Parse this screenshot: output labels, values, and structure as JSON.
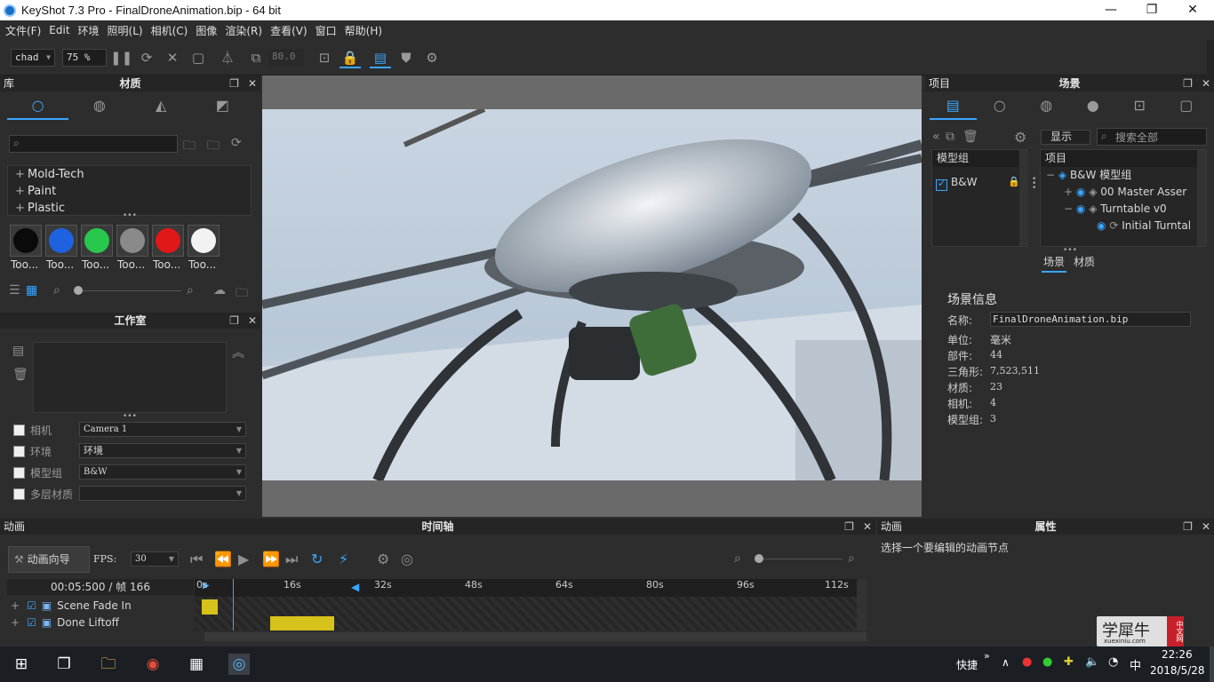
{
  "window": {
    "title": "KeyShot 7.3 Pro  - FinalDroneAnimation.bip  - 64 bit",
    "min": "—",
    "max": "❐",
    "close": "✕"
  },
  "menu": [
    "文件(F)",
    "Edit",
    "环境",
    "照明(L)",
    "相机(C)",
    "图像",
    "渲染(R)",
    "查看(V)",
    "窗口",
    "帮助(H)"
  ],
  "toolbar": {
    "preset": "chad",
    "zoom": "75 %",
    "value": "80.0"
  },
  "library": {
    "left_label": "库",
    "title": "材质",
    "search_placeholder": "",
    "items": [
      "Mold-Tech",
      "Paint",
      "Plastic"
    ],
    "swatches": [
      {
        "label": "Too...",
        "color": "#0a0a0a"
      },
      {
        "label": "Too...",
        "color": "#1f62e0"
      },
      {
        "label": "Too...",
        "color": "#28c84c"
      },
      {
        "label": "Too...",
        "color": "#8a8a8a"
      },
      {
        "label": "Too...",
        "color": "#e01818"
      },
      {
        "label": "Too...",
        "color": "#f2f2f2"
      }
    ]
  },
  "studio": {
    "title": "工作室",
    "rows": [
      {
        "label": "相机",
        "value": "Camera 1"
      },
      {
        "label": "环境",
        "value": "环境"
      },
      {
        "label": "模型组",
        "value": "B&W"
      },
      {
        "label": "多层材质",
        "value": ""
      }
    ]
  },
  "scene": {
    "left_label": "项目",
    "title": "场景",
    "display_btn": "显示",
    "search_placeholder": "搜索全部",
    "model_group_header": "模型组",
    "model_group_item": "B&W",
    "tree_header": "项目",
    "tree": [
      {
        "toggle": "−",
        "label": "B&W 模型组"
      },
      {
        "toggle": "+",
        "label": "00 Master Asser"
      },
      {
        "toggle": "−",
        "label": "Turntable v0"
      },
      {
        "toggle": "",
        "label": "Initial Turntal"
      }
    ],
    "subtabs": [
      "场景",
      "材质"
    ]
  },
  "scene_info": {
    "title": "场景信息",
    "name_label": "名称:",
    "name_value": "FinalDroneAnimation.bip",
    "fields": [
      {
        "label": "单位:",
        "value": "毫米"
      },
      {
        "label": "部件:",
        "value": "44"
      },
      {
        "label": "三角形:",
        "value": "7,523,511"
      },
      {
        "label": "材质:",
        "value": "23"
      },
      {
        "label": "相机:",
        "value": "4"
      },
      {
        "label": "模型组:",
        "value": "3"
      }
    ]
  },
  "animation": {
    "left_label": "动画",
    "title": "时间轴",
    "wizard": "动画向导",
    "fps_label": "FPS:",
    "fps_value": "30",
    "time_display": "00:05:500 / 帧 166",
    "ticks": [
      "0s",
      "16s",
      "32s",
      "48s",
      "64s",
      "80s",
      "96s",
      "112s"
    ],
    "tracks": [
      "Scene Fade In",
      "Done Liftoff"
    ]
  },
  "properties": {
    "left_label": "动画",
    "title": "属性",
    "hint": "选择一个要编辑的动画节点"
  },
  "watermark": {
    "text": "学犀牛",
    "sub": "xuexiniu.com",
    "tag": "中文网"
  },
  "taskbar": {
    "quick": "快捷",
    "ime": "中",
    "time": "22:26",
    "date": "2018/5/28"
  }
}
